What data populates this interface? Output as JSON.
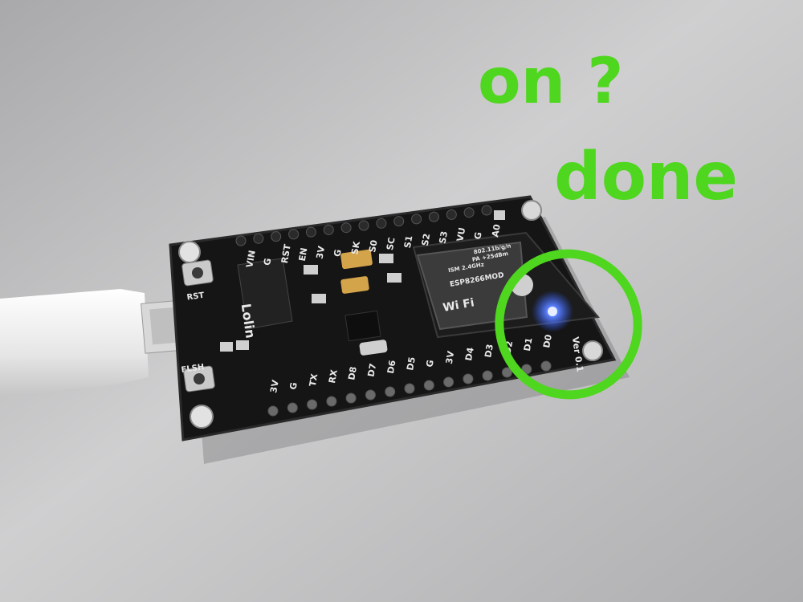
{
  "photo": {
    "subject": "NodeMCU ESP8266 development board on a grey desk, USB cable attached, blue LED lit",
    "colors": {
      "surface": "#b9b9bb",
      "pcb": "#141414",
      "silkscreen": "#e9e9e9",
      "led": "#2f5bff",
      "annotation": "#4fd61e",
      "cable": "#ececec"
    }
  },
  "annotation": {
    "line1": "on ?",
    "line2": "done",
    "circle_target": "blue-led-icon"
  },
  "board": {
    "brand": "Lolin",
    "button_rst": "RST",
    "button_flash": "FLSH",
    "top_pins": [
      "VIN",
      "G",
      "RST",
      "EN",
      "3V",
      "G",
      "SK",
      "S0",
      "SC",
      "S1",
      "S2",
      "S3",
      "VU",
      "G",
      "A0"
    ],
    "bottom_pins": [
      "3V",
      "G",
      "TX",
      "RX",
      "D8",
      "D7",
      "D6",
      "D5",
      "G",
      "3V",
      "D4",
      "D3",
      "D2",
      "D1",
      "D0"
    ],
    "version_label": "Ver 0.1",
    "module": {
      "label": "ESP8266MOD",
      "wifi_text": "Wi Fi",
      "fine_print": [
        "ISM 2.4GHz",
        "PA +25dBm",
        "802.11b/g/n"
      ]
    }
  }
}
